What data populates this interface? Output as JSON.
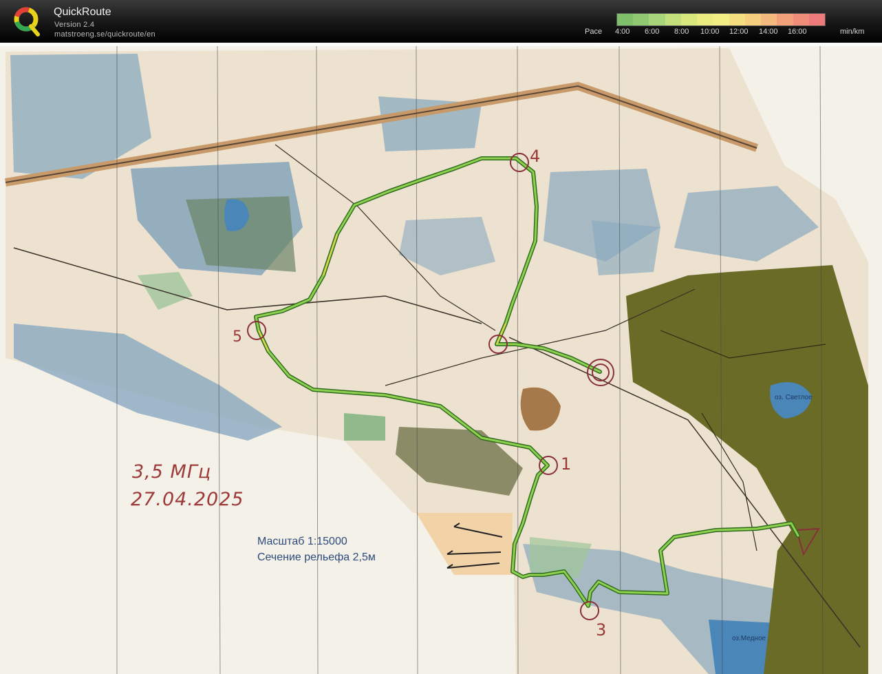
{
  "app": {
    "name": "QuickRoute",
    "version": "Version 2.4",
    "url": "matstroeng.se/quickroute/en"
  },
  "pace_legend": {
    "label": "Pace",
    "ticks": [
      "4:00",
      "6:00",
      "8:00",
      "10:00",
      "12:00",
      "14:00",
      "16:00"
    ],
    "unit": "min/km",
    "gradient_colors": [
      "#7fbf6a",
      "#a8d57a",
      "#d8e87c",
      "#f2ee84",
      "#f6cf7e",
      "#f2a07a",
      "#ee7a7a"
    ]
  },
  "map": {
    "handwritten_note_line1": "3,5 МГц",
    "handwritten_note_line2": "27.04.2025",
    "scale_line1": "Масштаб 1:15000",
    "scale_line2": "Сечение рельефа 2,5м",
    "lake_label_1": "оз. Светлое",
    "lake_label_2": "оз.Медное",
    "control_labels": [
      "1",
      "3",
      "4",
      "5"
    ],
    "route_color": "#4fb032",
    "control_color": "#8a2f3a"
  }
}
